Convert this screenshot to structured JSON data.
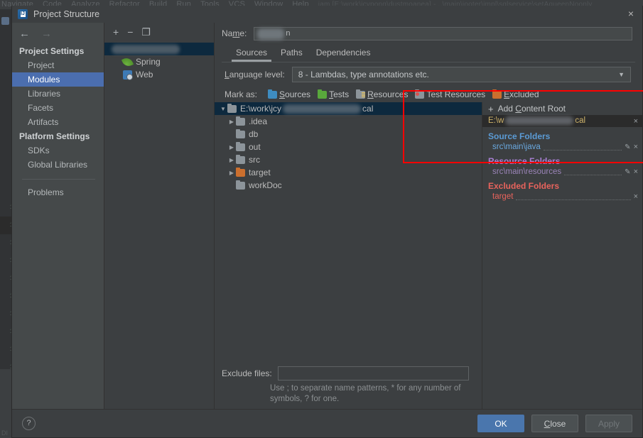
{
  "background": {
    "menu_items": [
      "Navigate",
      "Code",
      "Analyze",
      "Refactor",
      "Build",
      "Run",
      "Tools",
      "VCS",
      "Window",
      "Help"
    ],
    "breadcrumb": "iam [E:\\work\\jcypong\\dustmoanea] - ..\\main\\jooter\\impl\\sqlservice\\setAqueenNoonly",
    "line_numbers": [
      "1",
      "1",
      "1",
      "1",
      "1",
      "1",
      "1",
      "1",
      "1",
      "1",
      "1"
    ],
    "status_left": "DI"
  },
  "dialog": {
    "title": "Project Structure",
    "logo_letter": "IJ",
    "close_icon": "×"
  },
  "sidebar": {
    "back_icon": "←",
    "forward_icon": "→",
    "groups": [
      {
        "label": "Project Settings",
        "items": [
          {
            "label": "Project",
            "selected": false
          },
          {
            "label": "Modules",
            "selected": true
          },
          {
            "label": "Libraries",
            "selected": false
          },
          {
            "label": "Facets",
            "selected": false
          },
          {
            "label": "Artifacts",
            "selected": false
          }
        ]
      },
      {
        "label": "Platform Settings",
        "items": [
          {
            "label": "SDKs",
            "selected": false
          },
          {
            "label": "Global Libraries",
            "selected": false
          }
        ]
      }
    ],
    "problems_label": "Problems"
  },
  "modules_pane": {
    "toolbar": {
      "add_icon": "+",
      "remove_icon": "−",
      "copy_icon": "❐"
    },
    "module_name_redacted": "",
    "facets": [
      {
        "label": "Spring",
        "icon": "spring-leaf-icon"
      },
      {
        "label": "Web",
        "icon": "web-icon"
      }
    ]
  },
  "main": {
    "name_label_pre": "Na",
    "name_label_accel": "m",
    "name_label_post": "e:",
    "name_value_tail": "n",
    "tabs": [
      {
        "label": "Sources",
        "active": true
      },
      {
        "label": "Paths",
        "active": false
      },
      {
        "label": "Dependencies",
        "active": false
      }
    ],
    "language_level": {
      "label_accel": "L",
      "label_rest": "anguage level:",
      "value": "8 - Lambdas, type annotations etc.",
      "caret": "▼"
    },
    "mark_as": {
      "label": "Mark as:",
      "options": [
        {
          "label_accel": "S",
          "label_rest": "ources",
          "color": "#3e8cc0",
          "kind": "plain"
        },
        {
          "label_accel": "T",
          "label_rest": "ests",
          "color": "#59a83c",
          "kind": "plain"
        },
        {
          "label_accel": "R",
          "label_rest": "esources",
          "color": "#8c949a",
          "kind": "lines"
        },
        {
          "label_accel": "",
          "label_rest": "Test Resources",
          "color": "#8c949a",
          "kind": "testres"
        },
        {
          "label_accel": "E",
          "label_rest": "xcluded",
          "color": "#cb6f2e",
          "kind": "plain"
        }
      ]
    },
    "tree": [
      {
        "label": "E:\\work\\jcy",
        "label_tail": "cal",
        "depth": 0,
        "twisty": "▼",
        "selected": true,
        "redacted": true,
        "excluded": false
      },
      {
        "label": ".idea",
        "depth": 1,
        "twisty": "▶",
        "selected": false,
        "redacted": false,
        "excluded": false
      },
      {
        "label": "db",
        "depth": 1,
        "twisty": "",
        "selected": false,
        "redacted": false,
        "excluded": false
      },
      {
        "label": "out",
        "depth": 1,
        "twisty": "▶",
        "selected": false,
        "redacted": false,
        "excluded": false
      },
      {
        "label": "src",
        "depth": 1,
        "twisty": "▶",
        "selected": false,
        "redacted": false,
        "excluded": false
      },
      {
        "label": "target",
        "depth": 1,
        "twisty": "▶",
        "selected": false,
        "redacted": false,
        "excluded": true
      },
      {
        "label": "workDoc",
        "depth": 1,
        "twisty": "",
        "selected": false,
        "redacted": false,
        "excluded": false
      }
    ],
    "exclude_files": {
      "label": "Exclude files:",
      "value": "",
      "hint": "Use ; to separate name patterns, * for any number of symbols, ? for one."
    }
  },
  "right_panel": {
    "add_content_root": {
      "plus": "+",
      "text_pre": "Add ",
      "text_accel": "C",
      "text_post": "ontent Root"
    },
    "content_root_path_pre": "E:\\w",
    "content_root_path_post": "cal",
    "remove_icon": "×",
    "sections": [
      {
        "title": "Source Folders",
        "kind": "src",
        "items": [
          {
            "path": "src\\main\\java",
            "edit_icon": "✎",
            "remove_icon": "×"
          }
        ]
      },
      {
        "title": "Resource Folders",
        "kind": "res",
        "items": [
          {
            "path": "src\\main\\resources",
            "edit_icon": "✎",
            "remove_icon": "×"
          }
        ]
      },
      {
        "title": "Excluded Folders",
        "kind": "exc",
        "items": [
          {
            "path": "target",
            "edit_icon": "",
            "remove_icon": "×"
          }
        ]
      }
    ]
  },
  "footer": {
    "help_icon": "?",
    "buttons": [
      {
        "label": "OK",
        "accel": "",
        "style": "primary"
      },
      {
        "label_pre": "",
        "accel": "C",
        "label_post": "lose",
        "style": "normal"
      },
      {
        "label": "Apply",
        "accel": "",
        "style": "disabled"
      }
    ]
  },
  "annotation": {
    "color": "#fe0000"
  }
}
